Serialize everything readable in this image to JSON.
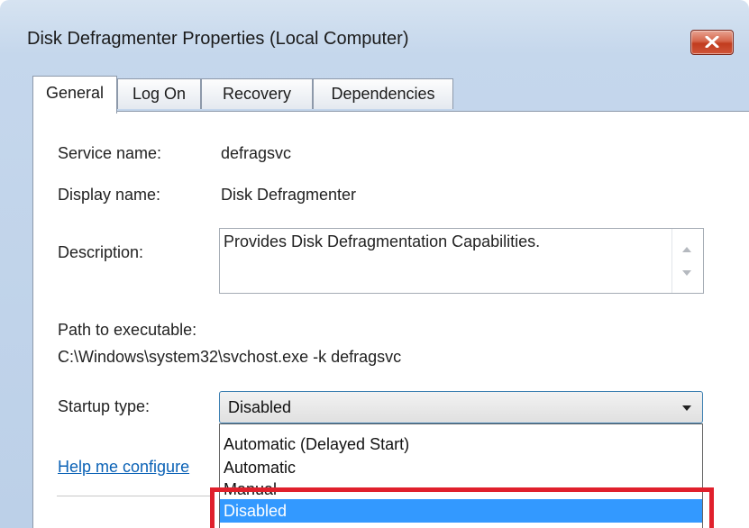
{
  "window": {
    "title": "Disk Defragmenter Properties (Local Computer)",
    "close_label": "close"
  },
  "tabs": [
    {
      "label": "General",
      "active": true
    },
    {
      "label": "Log On",
      "active": false
    },
    {
      "label": "Recovery",
      "active": false
    },
    {
      "label": "Dependencies",
      "active": false
    }
  ],
  "general": {
    "service_name_label": "Service name:",
    "service_name_value": "defragsvc",
    "display_name_label": "Display name:",
    "display_name_value": "Disk Defragmenter",
    "description_label": "Description:",
    "description_value": "Provides Disk Defragmentation Capabilities.",
    "path_label": "Path to executable:",
    "path_value": "C:\\Windows\\system32\\svchost.exe -k defragsvc",
    "startup_type_label": "Startup type:",
    "startup_type_value": "Disabled",
    "help_link": "Help me configure"
  },
  "startup_options": [
    {
      "label": "Automatic (Delayed Start)"
    },
    {
      "label": "Automatic"
    },
    {
      "label": "Manual"
    },
    {
      "label": "Disabled",
      "selected": true
    }
  ],
  "colors": {
    "selection": "#3399ff",
    "highlight": "#e0202c",
    "link": "#0b62b6"
  }
}
